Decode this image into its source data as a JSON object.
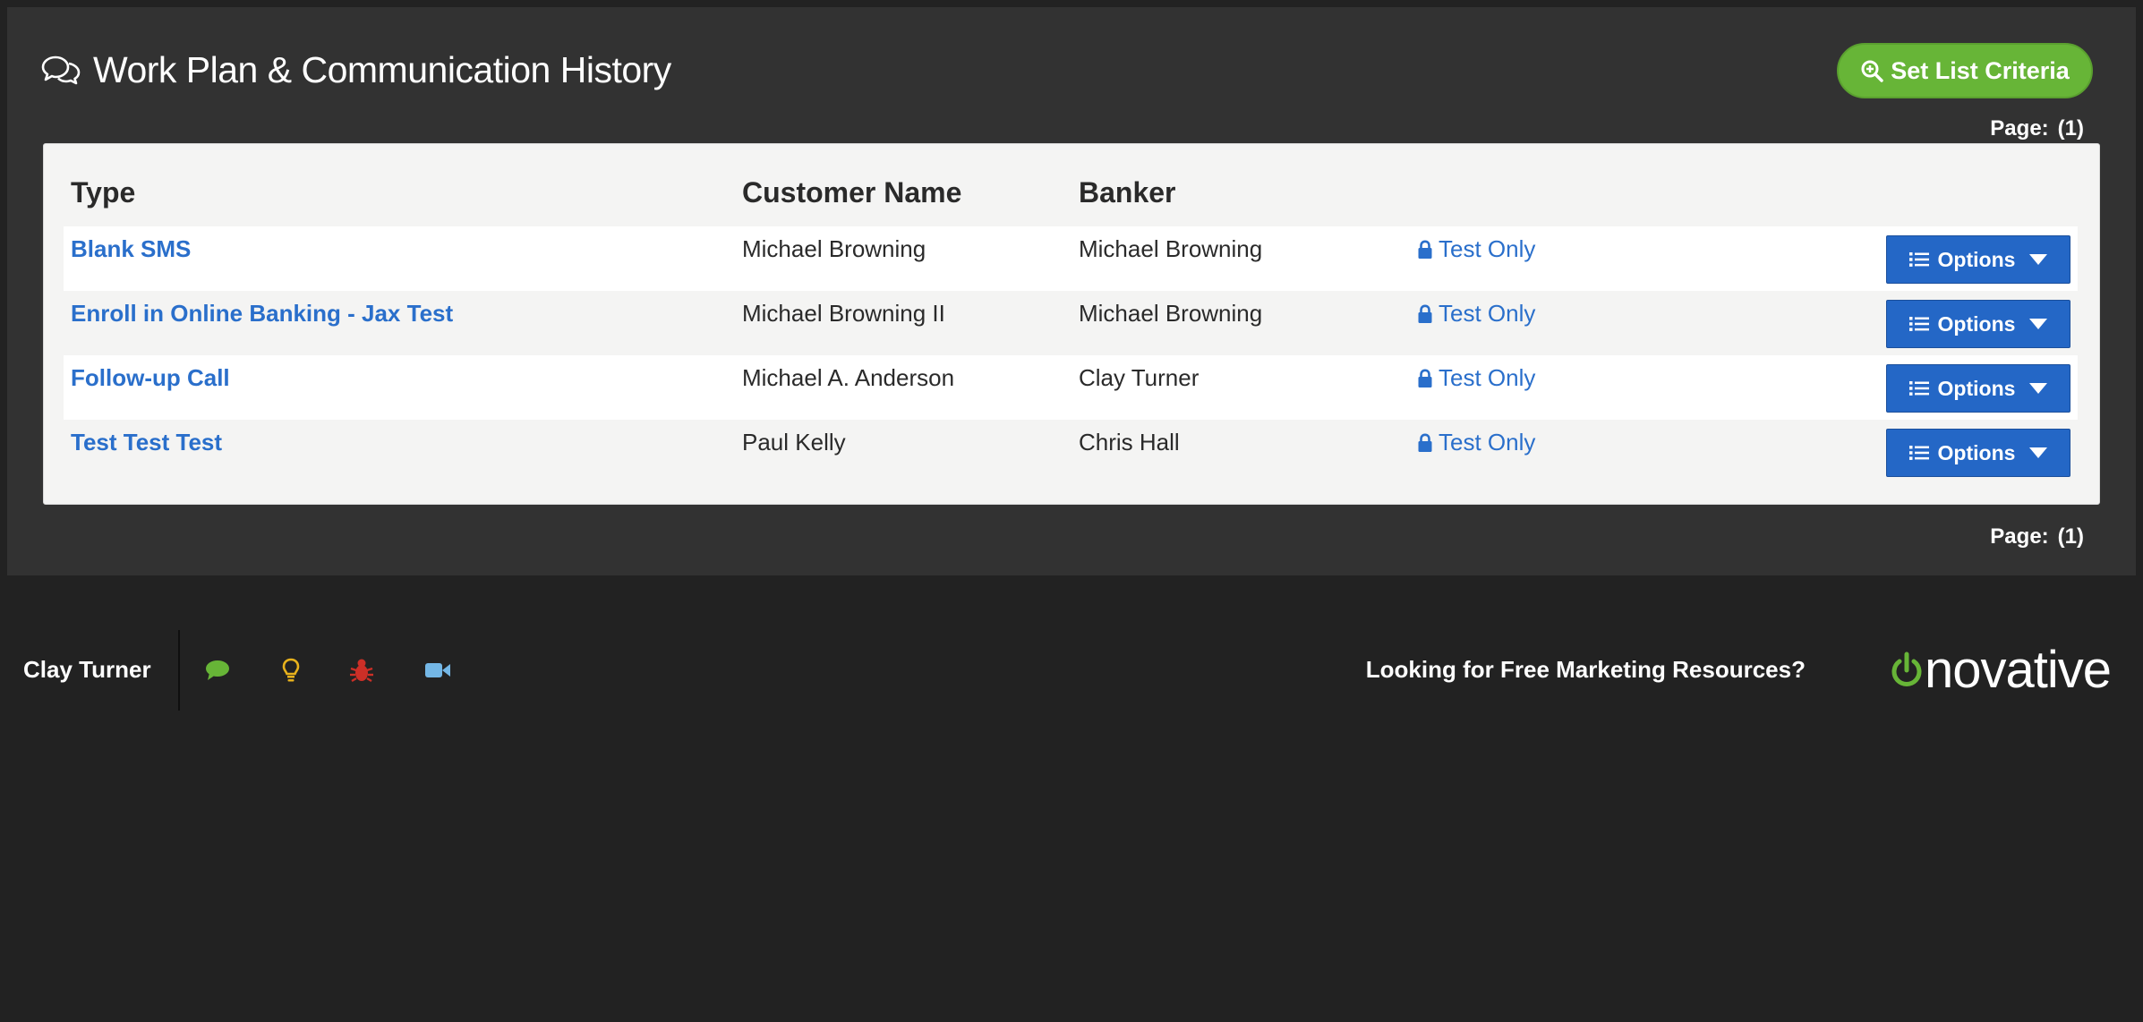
{
  "page": {
    "title": "Work Plan & Communication History",
    "criteria_button": "Set List Criteria",
    "pager_label": "Page:",
    "pager_value": "(1)"
  },
  "table": {
    "headers": {
      "type": "Type",
      "customer": "Customer Name",
      "banker": "Banker"
    },
    "rows": [
      {
        "type": "Blank SMS",
        "customer": "Michael Browning",
        "banker": "Michael Browning",
        "status": "Test Only",
        "options": "Options"
      },
      {
        "type": "Enroll in Online Banking - Jax Test",
        "customer": "Michael Browning II",
        "banker": "Michael Browning",
        "status": "Test Only",
        "options": "Options"
      },
      {
        "type": "Follow-up Call",
        "customer": "Michael A. Anderson",
        "banker": "Clay Turner",
        "status": "Test Only",
        "options": "Options"
      },
      {
        "type": "Test Test Test",
        "customer": "Paul Kelly",
        "banker": "Chris Hall",
        "status": "Test Only",
        "options": "Options"
      }
    ]
  },
  "footer": {
    "user": "Clay Turner",
    "icons": [
      "chat-icon",
      "lightbulb-icon",
      "bug-icon",
      "video-icon"
    ],
    "marketing_link": "Looking for Free Marketing Resources?",
    "logo_text": "novative",
    "logo_wordmark": "onovative"
  },
  "colors": {
    "accent_green": "#67b537",
    "link_blue": "#2a6fcb",
    "button_blue": "#2467c6",
    "background": "#222222",
    "panel": "#323232"
  }
}
